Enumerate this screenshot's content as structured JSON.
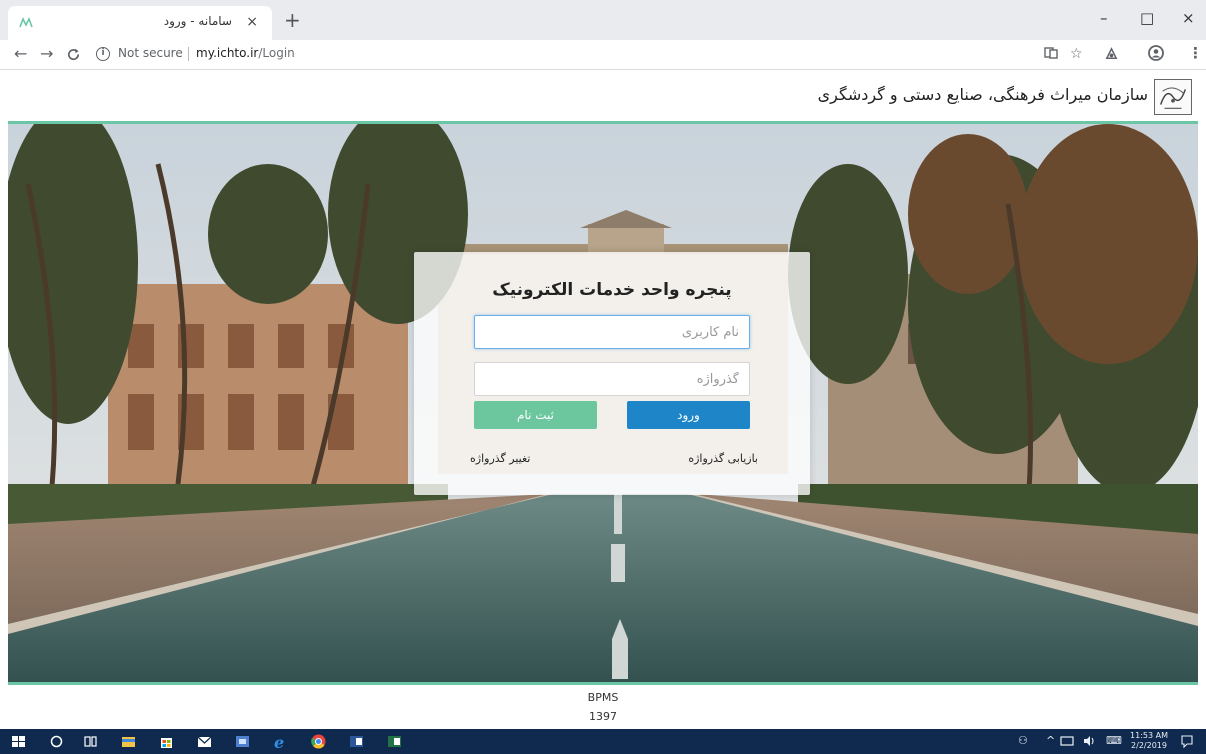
{
  "browser": {
    "tab_title": "سامانه - ورود",
    "new_tab_glyph": "+",
    "tab_close_glyph": "×",
    "address": {
      "security_label": "Not secure",
      "url_host": "my.ichto.ir",
      "url_path": "/Login"
    },
    "controls": {
      "minimize": "–",
      "maximize": "□",
      "close": "×"
    }
  },
  "header": {
    "org_title": "سازمان میراث فرهنگی، صنایع دستی و گردشگری"
  },
  "login": {
    "title": "پنجره واحد خدمات الکترونیک",
    "username_placeholder": "نام کاربری",
    "password_placeholder": "گذرواژه",
    "login_button": "ورود",
    "register_button": "ثبت نام",
    "recover_link": "بازیابی گذرواژه",
    "change_link": "تغییر گذرواژه"
  },
  "footer": {
    "line1": "BPMS",
    "line2": "1397"
  },
  "taskbar": {
    "time": "11:53 AM",
    "date": "2/2/2019"
  },
  "colors": {
    "accent_green": "#6ac6a4",
    "login_blue": "#1e86c8",
    "register_green": "#6cc79f",
    "taskbar": "#0f2a4e"
  }
}
